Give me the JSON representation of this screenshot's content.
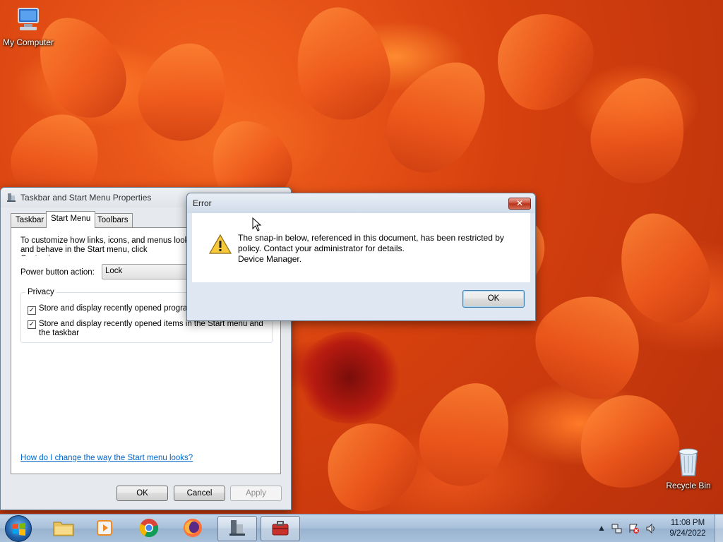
{
  "desktop": {
    "icons": [
      {
        "label": "My Computer"
      },
      {
        "label": "Recycle Bin"
      }
    ]
  },
  "taskbar_properties": {
    "title": "Taskbar and Start Menu Properties",
    "tabs": [
      "Taskbar",
      "Start Menu",
      "Toolbars"
    ],
    "active_tab": "Start Menu",
    "description": "To customize how links, icons, and menus look and behave in the Start menu, click Customize.",
    "power_button_label": "Power button action:",
    "power_button_value": "Lock",
    "privacy_legend": "Privacy",
    "checkbox_programs": "Store and display recently opened programs in the Start menu",
    "checkbox_items": "Store and display recently opened items in the Start menu and the taskbar",
    "help_link": "How do I change the way the Start menu looks?",
    "ok_label": "OK",
    "cancel_label": "Cancel",
    "apply_label": "Apply"
  },
  "error_dialog": {
    "title": "Error",
    "message_line1": "The snap-in below, referenced in this document, has been restricted by",
    "message_line2": "policy. Contact your administrator for details.",
    "message_line3": "Device Manager.",
    "ok_label": "OK",
    "icon": "warning-icon"
  },
  "taskbar": {
    "time": "11:08 PM",
    "date": "9/24/2022",
    "pinned": [
      "start-orb",
      "file-explorer-icon",
      "media-player-icon",
      "chrome-icon",
      "firefox-icon",
      "taskbar-properties-icon",
      "toolbox-icon"
    ]
  },
  "colors": {
    "accent_link": "#0066cc",
    "close_red": "#c8452d"
  }
}
